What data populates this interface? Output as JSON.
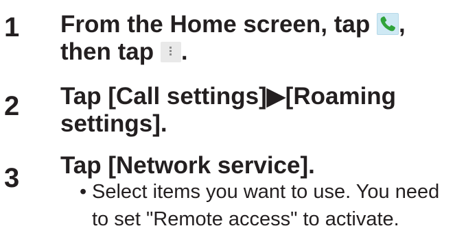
{
  "steps": [
    {
      "number": "1",
      "line1_before_phone": "From the Home screen, tap ",
      "line1_after_phone": ",",
      "line2_before_menu": "then tap ",
      "line2_after_menu": ".",
      "phone_icon": "phone-icon",
      "menu_icon": "menu-icon"
    },
    {
      "number": "2",
      "line1": "Tap [Call settings]▶[Roaming",
      "line2": "settings]."
    },
    {
      "number": "3",
      "line1": "Tap [Network service].",
      "bullet": "•",
      "note_line1": "Select items you want to use. You need",
      "note_line2": "to set \"Remote access\" to activate."
    }
  ],
  "colors": {
    "text": "#231f20",
    "phone_icon_bg": "#cfe9f4",
    "phone_icon_green": "#2fa33a",
    "menu_icon_bg": "#e9e9e9"
  }
}
